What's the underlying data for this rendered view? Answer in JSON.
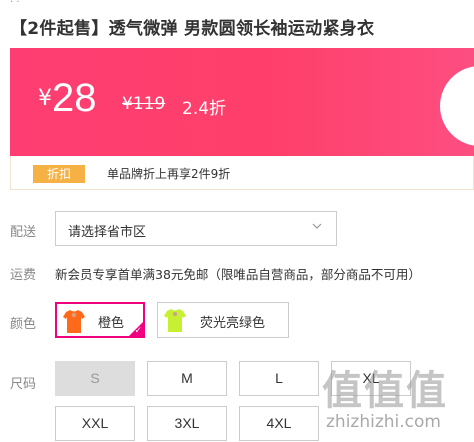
{
  "product": {
    "title": "【2件起售】透气微弹 男款圆领长袖运动紧身衣"
  },
  "price": {
    "currency": "¥",
    "current": "28",
    "original": "¥119",
    "discount": "2.4折"
  },
  "promo": {
    "tag": "折扣",
    "text": "单品牌折上再享2件9折"
  },
  "delivery": {
    "label": "配送",
    "placeholder": "请选择省市区"
  },
  "shipping": {
    "label": "运费",
    "text": "新会员专享首单满38元免邮（限唯品自营商品，部分商品不可用）"
  },
  "color": {
    "label": "颜色",
    "options": [
      {
        "label": "橙色",
        "selected": true,
        "swatch": "#ff6a1a"
      },
      {
        "label": "荧光亮绿色",
        "selected": false,
        "swatch": "#c8f032"
      }
    ]
  },
  "size": {
    "label": "尺码",
    "options": [
      {
        "label": "S",
        "disabled": true
      },
      {
        "label": "M",
        "disabled": false
      },
      {
        "label": "L",
        "disabled": false
      },
      {
        "label": "XL",
        "disabled": false
      },
      {
        "label": "XXL",
        "disabled": false
      },
      {
        "label": "3XL",
        "disabled": false
      },
      {
        "label": "4XL",
        "disabled": false
      }
    ]
  },
  "watermark": {
    "glyphs": "值值值",
    "url": "zhizhizhi.com"
  },
  "colors": {
    "accent": "#f10180",
    "banner": "#fe3e72",
    "promo_tag": "#f6b144"
  }
}
